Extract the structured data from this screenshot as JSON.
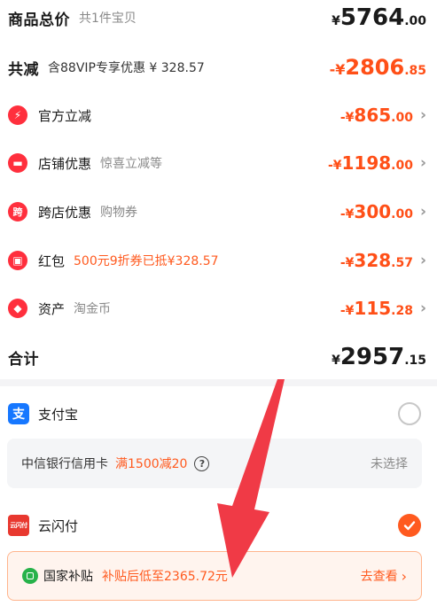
{
  "total": {
    "label": "商品总价",
    "sub": "共1件宝贝",
    "currency": "¥",
    "integer": "5764",
    "decimal": ".00"
  },
  "discount": {
    "label": "共减",
    "sub": "含88VIP专享优惠 ¥ 328.57",
    "prefix": "-¥",
    "integer": "2806",
    "decimal": ".85"
  },
  "items": [
    {
      "label": "官方立减",
      "sub": "",
      "icon": "lightning-icon",
      "icon_char": "⚡",
      "color": "#ff2f3d",
      "prefix": "-¥",
      "integer": "865",
      "decimal": ".00"
    },
    {
      "label": "店铺优惠",
      "sub": "惊喜立减等",
      "icon": "store-icon",
      "icon_char": "▬",
      "color": "#ff2f3d",
      "prefix": "-¥",
      "integer": "1198",
      "decimal": ".00"
    },
    {
      "label": "跨店优惠",
      "sub": "购物券",
      "icon": "cross-store-icon",
      "icon_char": "跨",
      "color": "#ff2f3d",
      "prefix": "-¥",
      "integer": "300",
      "decimal": ".00"
    },
    {
      "label": "红包",
      "sub": "500元9折券已抵¥328.57",
      "icon": "red-packet-icon",
      "icon_char": "▣",
      "color": "#ff2f3d",
      "prefix": "-¥",
      "integer": "328",
      "decimal": ".57"
    },
    {
      "label": "资产",
      "sub": "淘金币",
      "icon": "tag-icon",
      "icon_char": "◆",
      "color": "#ff2f3d",
      "prefix": "-¥",
      "integer": "115",
      "decimal": ".28"
    }
  ],
  "sum": {
    "label": "合计",
    "currency": "¥",
    "integer": "2957",
    "decimal": ".15"
  },
  "payment": {
    "alipay": {
      "label": "支付宝",
      "icon_char": "支"
    },
    "bank": {
      "name": "中信银行信用卡",
      "promo": "满1500减20",
      "help": "?",
      "status": "未选择"
    },
    "unionpay": {
      "label": "云闪付",
      "icon_char": "云闪付"
    },
    "subsidy": {
      "label": "国家补贴",
      "desc": "补贴后低至2365.72元",
      "action": "去查看"
    }
  },
  "colors": {
    "orange": "#ff4f17",
    "red_icon": "#ff2f3d",
    "alipay_blue": "#1677ff",
    "subsidy_green": "#27b24a",
    "arrow_red": "#f03a46"
  }
}
